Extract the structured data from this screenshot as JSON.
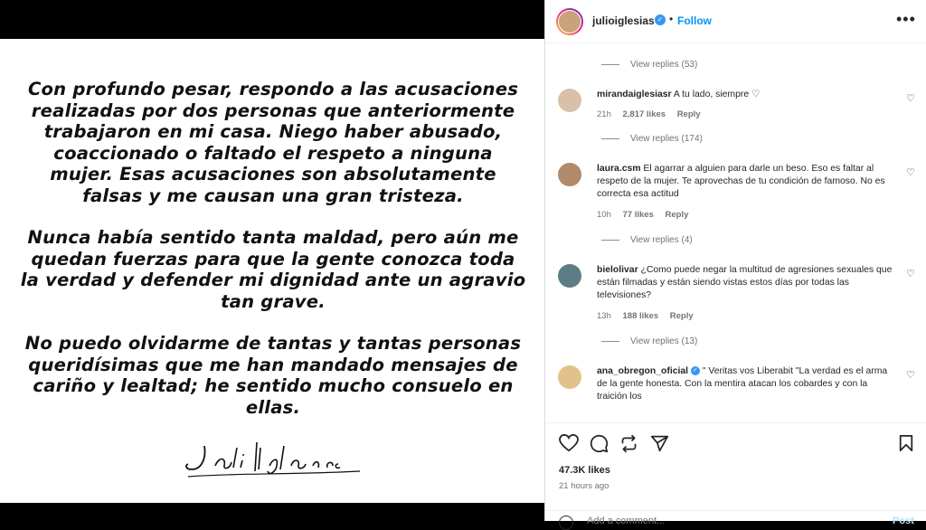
{
  "post": {
    "paragraphs": [
      "Con profundo pesar, respondo a las acusaciones realizadas por dos personas que anteriormente trabajaron en mi casa. Niego haber abusado, coaccionado o faltado el respeto a ninguna mujer. Esas acusaciones son absolutamente falsas y me causan una gran tristeza.",
      "Nunca había sentido tanta maldad, pero aún me quedan fuerzas para que la gente conozca toda la verdad y defender mi dignidad ante un agravio tan grave.",
      "No puedo olvidarme de tantas y tantas personas queridísimas que me han mandado mensajes de cariño y lealtad; he sentido mucho consuelo en ellas."
    ],
    "signature": "Julio Iglesias"
  },
  "header": {
    "username": "julioiglesias",
    "separator": "•",
    "follow_label": "Follow",
    "more_icon": "more-horizontal-icon"
  },
  "comments": {
    "view_replies": [
      "View replies (53)",
      "View replies (174)",
      "View replies (4)",
      "View replies (13)"
    ],
    "items": [
      {
        "username": "mirandaiglesiasr",
        "text": "A tu lado, siempre ♡",
        "time": "21h",
        "likes": "2,817 likes",
        "reply": "Reply"
      },
      {
        "username": "laura.csm",
        "text": "El agarrar a alguien para darle un beso. Eso es faltar al respeto de la mujer. Te aprovechas de tu condición de famoso. No es correcta esa actitud",
        "time": "10h",
        "likes": "77 likes",
        "reply": "Reply"
      },
      {
        "username": "bielolivar",
        "text": "¿Como puede negar la multitud de agresiones sexuales que están filmadas y están siendo vistas estos días por todas las televisiones?",
        "time": "13h",
        "likes": "188 likes",
        "reply": "Reply"
      },
      {
        "username": "ana_obregon_oficial",
        "text": "\" Veritas vos Liberabit \"La verdad es el arma de la gente honesta. Con la mentira atacan los cobardes y con la traición los",
        "time": "",
        "likes": "",
        "reply": ""
      }
    ]
  },
  "actions": {
    "likes_total": "47.3K likes",
    "time_ago": "21 hours ago",
    "add_comment_placeholder": "Add a comment...",
    "post_label": "Post"
  },
  "colors": {
    "accent": "#0095f6",
    "verified": "#3897f0",
    "text": "#262626",
    "muted": "#737373"
  }
}
